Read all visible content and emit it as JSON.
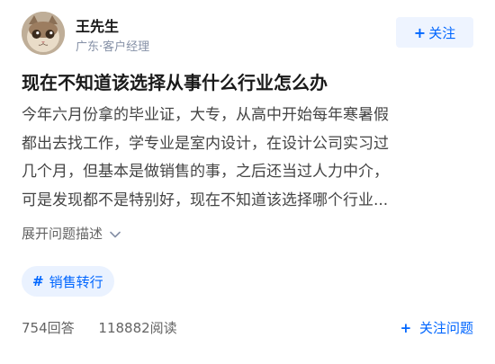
{
  "author": {
    "name": "王先生",
    "meta": "广东·客户经理",
    "follow_label": "关注"
  },
  "question": {
    "title": "现在不知道该选择从事什么行业怎么办",
    "description_lines": [
      "今年六月份拿的毕业证，大专，从高中开始每年寒暑假",
      "都出去找工作，学专业是室内设计，在设计公司实习过",
      "几个月，但基本是做销售的事，之后还当过人力中介，",
      "可是发现都不是特别好，现在不知道该选择哪个行业..."
    ],
    "expand_label": "展开问题描述"
  },
  "topic": {
    "label": "销售转行"
  },
  "stats": {
    "answers": "754回答",
    "reads": "118882阅读"
  },
  "follow_question_label": "关注问题",
  "colors": {
    "accent": "#0066ff",
    "accent_bg": "#eef4ff",
    "muted": "#8590a6"
  }
}
